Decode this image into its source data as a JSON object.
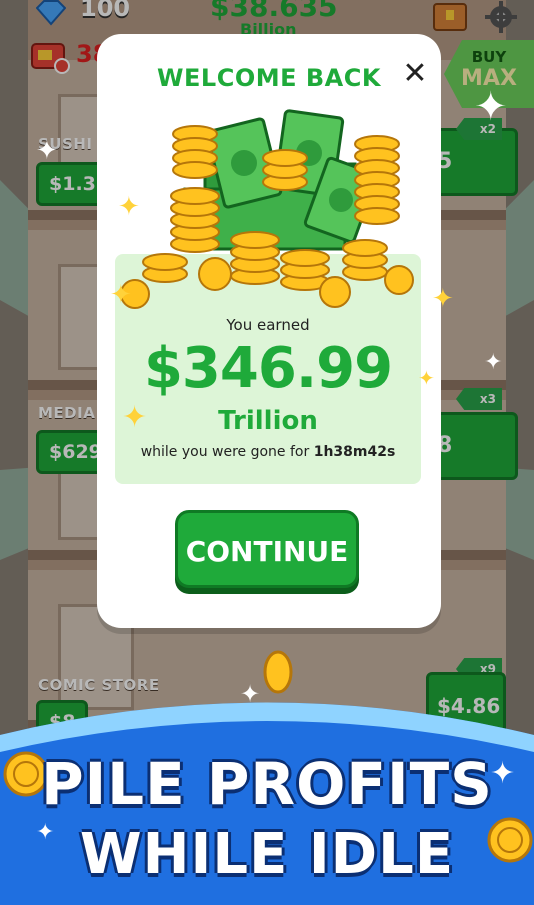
{
  "hud": {
    "gems": "100",
    "cash_partial": "38",
    "balance": "$38.635",
    "balance_unit": "Billion",
    "buy_label": "BUY",
    "max_label": "MAX",
    "multiplier_top": "x2"
  },
  "stores": [
    {
      "name": "SUSHI BA",
      "price": "$1.36",
      "right_value": "5",
      "multiplier": ""
    },
    {
      "name": "MEDIA H",
      "price": "$629.",
      "right_value": "8",
      "multiplier": "x3"
    },
    {
      "name": "COMIC STORE",
      "price": "$8",
      "right_value": "$4.86",
      "multiplier": "x9"
    }
  ],
  "modal": {
    "title": "WELCOME BACK",
    "close_label": "✕",
    "earned_label": "You earned",
    "earned_value": "$346.99",
    "earned_unit": "Trillion",
    "gone_prefix": "while you were gone for",
    "gone_duration": "1h38m42s",
    "continue_label": "CONTINUE"
  },
  "banner": {
    "line1": "PILE PROFITS",
    "line2": "WHILE IDLE"
  },
  "colors": {
    "accent_green": "#1faa3a",
    "panel_green": "#ddf5d7",
    "banner_blue": "#1f6fe0"
  }
}
